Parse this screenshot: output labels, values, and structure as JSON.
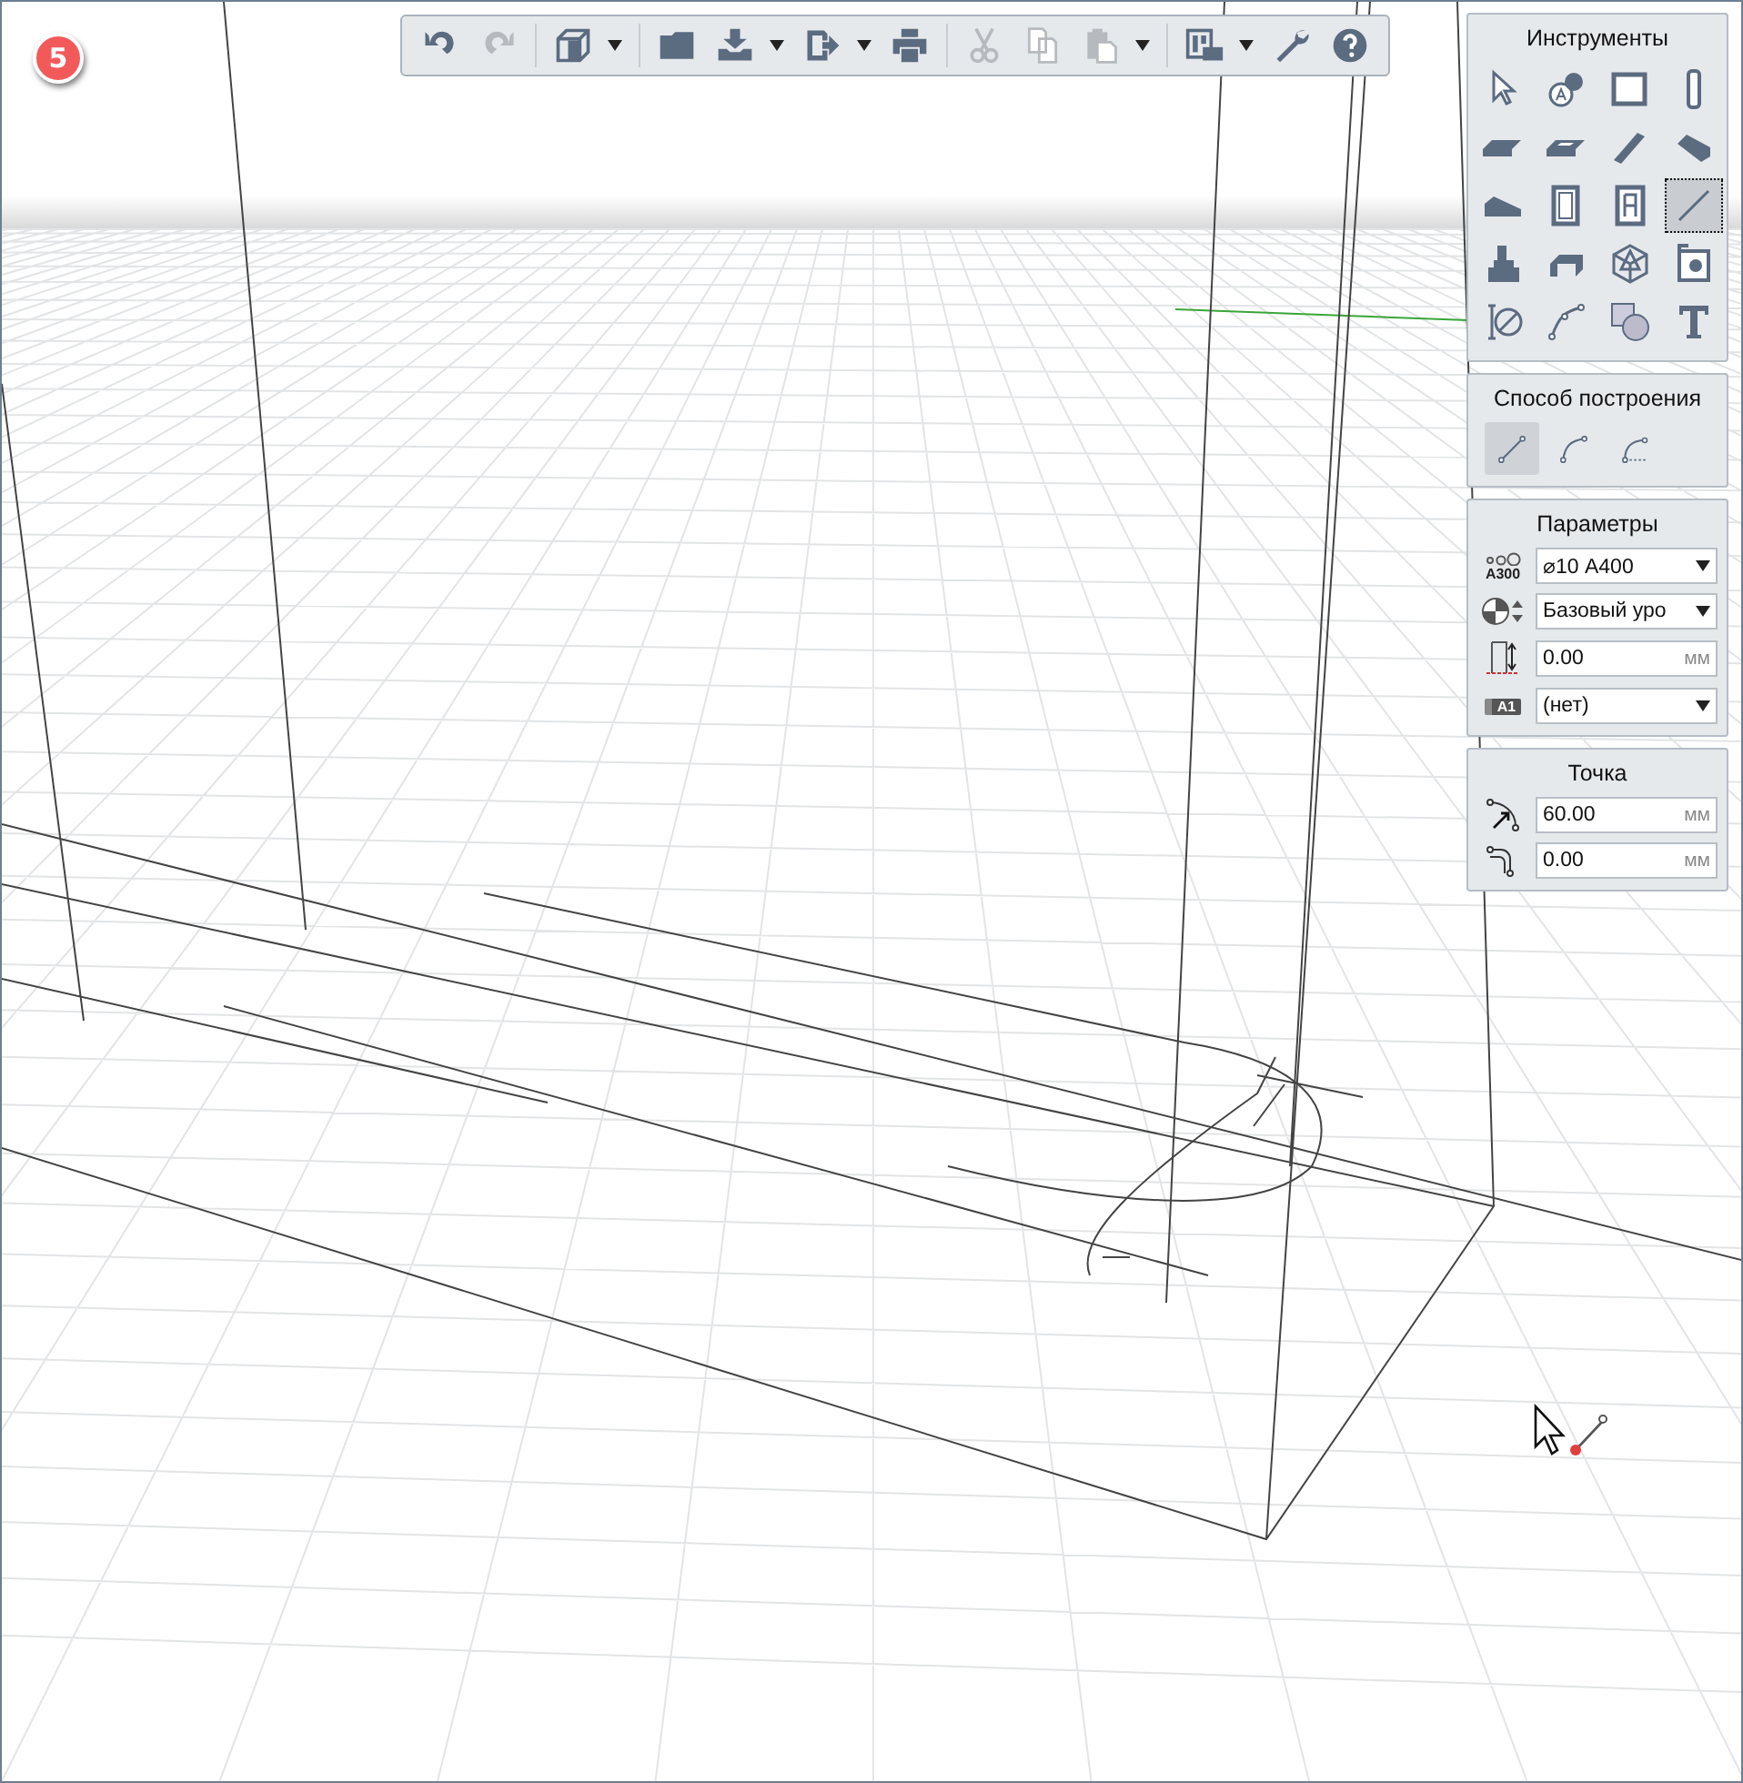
{
  "step_badge": "5",
  "toolbar": {
    "groups": [
      [
        {
          "disabled": false,
          "dropdown": false
        },
        {
          "disabled": true,
          "dropdown": false
        }
      ],
      [
        {
          "disabled": false,
          "dropdown": true
        }
      ],
      [
        {
          "disabled": false,
          "dropdown": false
        },
        {
          "disabled": false,
          "dropdown": true
        },
        {
          "disabled": false,
          "dropdown": true
        },
        {
          "disabled": false,
          "dropdown": false
        }
      ],
      [
        {
          "disabled": true,
          "dropdown": false
        },
        {
          "disabled": true,
          "dropdown": false
        },
        {
          "disabled": true,
          "dropdown": true
        }
      ],
      [
        {
          "disabled": false,
          "dropdown": true
        },
        {
          "disabled": false,
          "dropdown": false
        },
        {
          "disabled": false,
          "dropdown": false
        }
      ]
    ]
  },
  "tools_panel": {
    "title": "Инструменты",
    "tools": [
      {
        "selected": false
      },
      {
        "selected": false
      },
      {
        "selected": false
      },
      {
        "selected": false
      },
      {
        "selected": false
      },
      {
        "selected": false
      },
      {
        "selected": false
      },
      {
        "selected": false
      },
      {
        "selected": false
      },
      {
        "selected": false
      },
      {
        "selected": false
      },
      {
        "selected": true
      },
      {
        "selected": false
      },
      {
        "selected": false
      },
      {
        "selected": false
      },
      {
        "selected": false
      },
      {
        "selected": false
      },
      {
        "selected": false
      },
      {
        "selected": false
      },
      {
        "selected": false
      }
    ]
  },
  "method_panel": {
    "title": "Способ построения",
    "methods": [
      {
        "selected": true
      },
      {
        "selected": false
      },
      {
        "selected": false
      }
    ]
  },
  "parameters_panel": {
    "title": "Параметры",
    "rows": [
      {
        "kind": "select",
        "icon_label": "A300",
        "value": "⌀10 А400"
      },
      {
        "kind": "select",
        "value": "Базовый уро"
      },
      {
        "kind": "number",
        "value": "0.00",
        "unit": "мм"
      },
      {
        "kind": "select",
        "icon_label": "A1",
        "value": "(нет)"
      }
    ]
  },
  "point_panel": {
    "title": "Точка",
    "rows": [
      {
        "kind": "number",
        "value": "60.00",
        "unit": "мм"
      },
      {
        "kind": "number",
        "value": "0.00",
        "unit": "мм"
      }
    ]
  }
}
